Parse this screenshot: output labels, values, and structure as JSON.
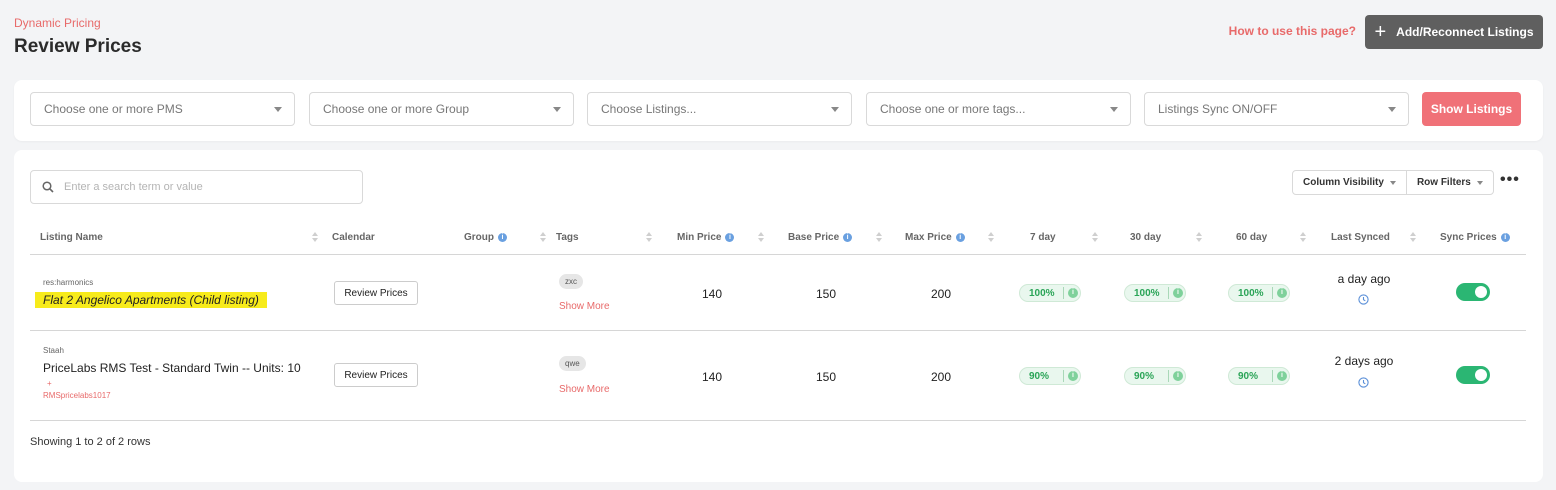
{
  "header": {
    "breadcrumb": "Dynamic Pricing",
    "title": "Review Prices",
    "help_link": "How to use this page?",
    "add_button": "Add/Reconnect Listings"
  },
  "filters": {
    "pms_placeholder": "Choose one or more PMS",
    "group_placeholder": "Choose one or more Group",
    "listings_placeholder": "Choose Listings...",
    "tags_placeholder": "Choose one or more tags...",
    "sync_placeholder": "Listings Sync ON/OFF",
    "show_button": "Show Listings"
  },
  "toolbar": {
    "search_placeholder": "Enter a search term or value",
    "column_visibility": "Column Visibility",
    "row_filters": "Row Filters",
    "more": "•••"
  },
  "columns": {
    "listing_name": "Listing Name",
    "calendar": "Calendar",
    "group": "Group",
    "tags": "Tags",
    "min_price": "Min Price",
    "base_price": "Base Price",
    "max_price": "Max Price",
    "d7": "7 day",
    "d30": "30 day",
    "d60": "60 day",
    "last_synced": "Last Synced",
    "sync_prices": "Sync Prices"
  },
  "rows": [
    {
      "source": "res:harmonics",
      "name": "Flat 2 Angelico Apartments (Child listing)",
      "review_label": "Review Prices",
      "tag": "zxc",
      "show_more": "Show More",
      "min_price": "140",
      "base_price": "150",
      "max_price": "200",
      "occ_7": "100%",
      "occ_30": "100%",
      "occ_60": "100%",
      "last_synced": "a day ago",
      "sync_on": true
    },
    {
      "source": "Staah",
      "name": "PriceLabs RMS Test - Standard Twin -- Units: 10",
      "sub_plus": "+",
      "sub_id": "RMSpricelabs1017",
      "review_label": "Review Prices",
      "tag": "qwe",
      "show_more": "Show More",
      "min_price": "140",
      "base_price": "150",
      "max_price": "200",
      "occ_7": "90%",
      "occ_30": "90%",
      "occ_60": "90%",
      "last_synced": "2 days ago",
      "sync_on": true
    }
  ],
  "footer": {
    "showing": "Showing 1 to 2 of 2 rows"
  },
  "colors": {
    "accent": "#e86a6a",
    "primary_button": "#f07178",
    "toggle_on": "#2bb673",
    "highlight": "#f7eb1b"
  }
}
